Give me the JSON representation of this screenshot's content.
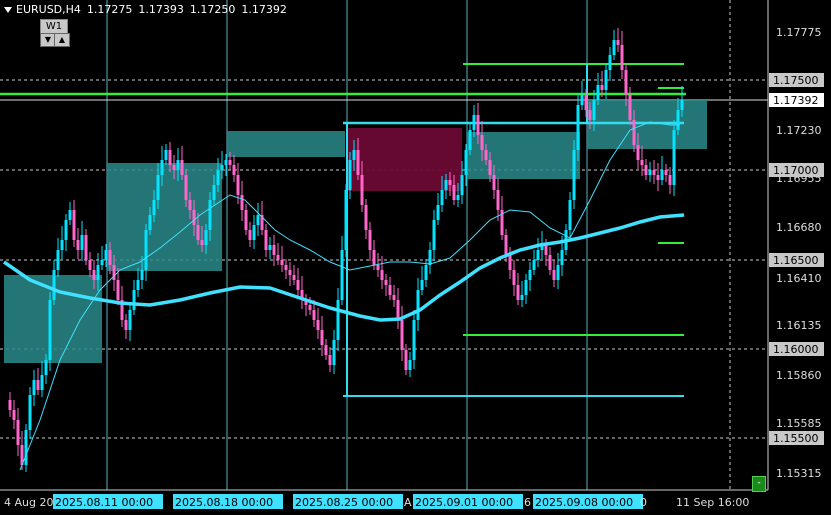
{
  "header": {
    "symbol": "EURUSD,H4",
    "open": "1.17275",
    "high": "1.17393",
    "low": "1.17250",
    "close": "1.17392"
  },
  "timeframe_widget": {
    "label": "W1",
    "down_glyph": "▼",
    "up_glyph": "▲"
  },
  "corner_button": "-",
  "price_axis": {
    "ticks": [
      "1.17775",
      "1.17230",
      "1.16955",
      "1.16680",
      "1.16410",
      "1.16135",
      "1.15860",
      "1.15585",
      "1.15315"
    ],
    "level_labels": [
      "1.17500",
      "1.17000",
      "1.16500",
      "1.16000",
      "1.15500"
    ],
    "current_price": "1.17392"
  },
  "time_axis": {
    "labels": [
      "4 Aug 20",
      "2025.08.11 00:00",
      "2025.08.18 00:00",
      "2025.08.25 00:00",
      "A",
      "2025.09.01 00:00",
      "6",
      "2025.09.08 00:00",
      "0",
      "11 Sep 16:00"
    ]
  },
  "colors": {
    "background": "#000000",
    "bull_candle": "#00e5ff",
    "bear_candle": "#ff66cc",
    "ma_slow": "#40e0ff",
    "ma_fast": "#40e0ff",
    "green_level": "#33ee33",
    "cyan_level": "#33ddee",
    "zone_teal": "#2a8a8a",
    "zone_maroon": "#6a0a34"
  }
}
